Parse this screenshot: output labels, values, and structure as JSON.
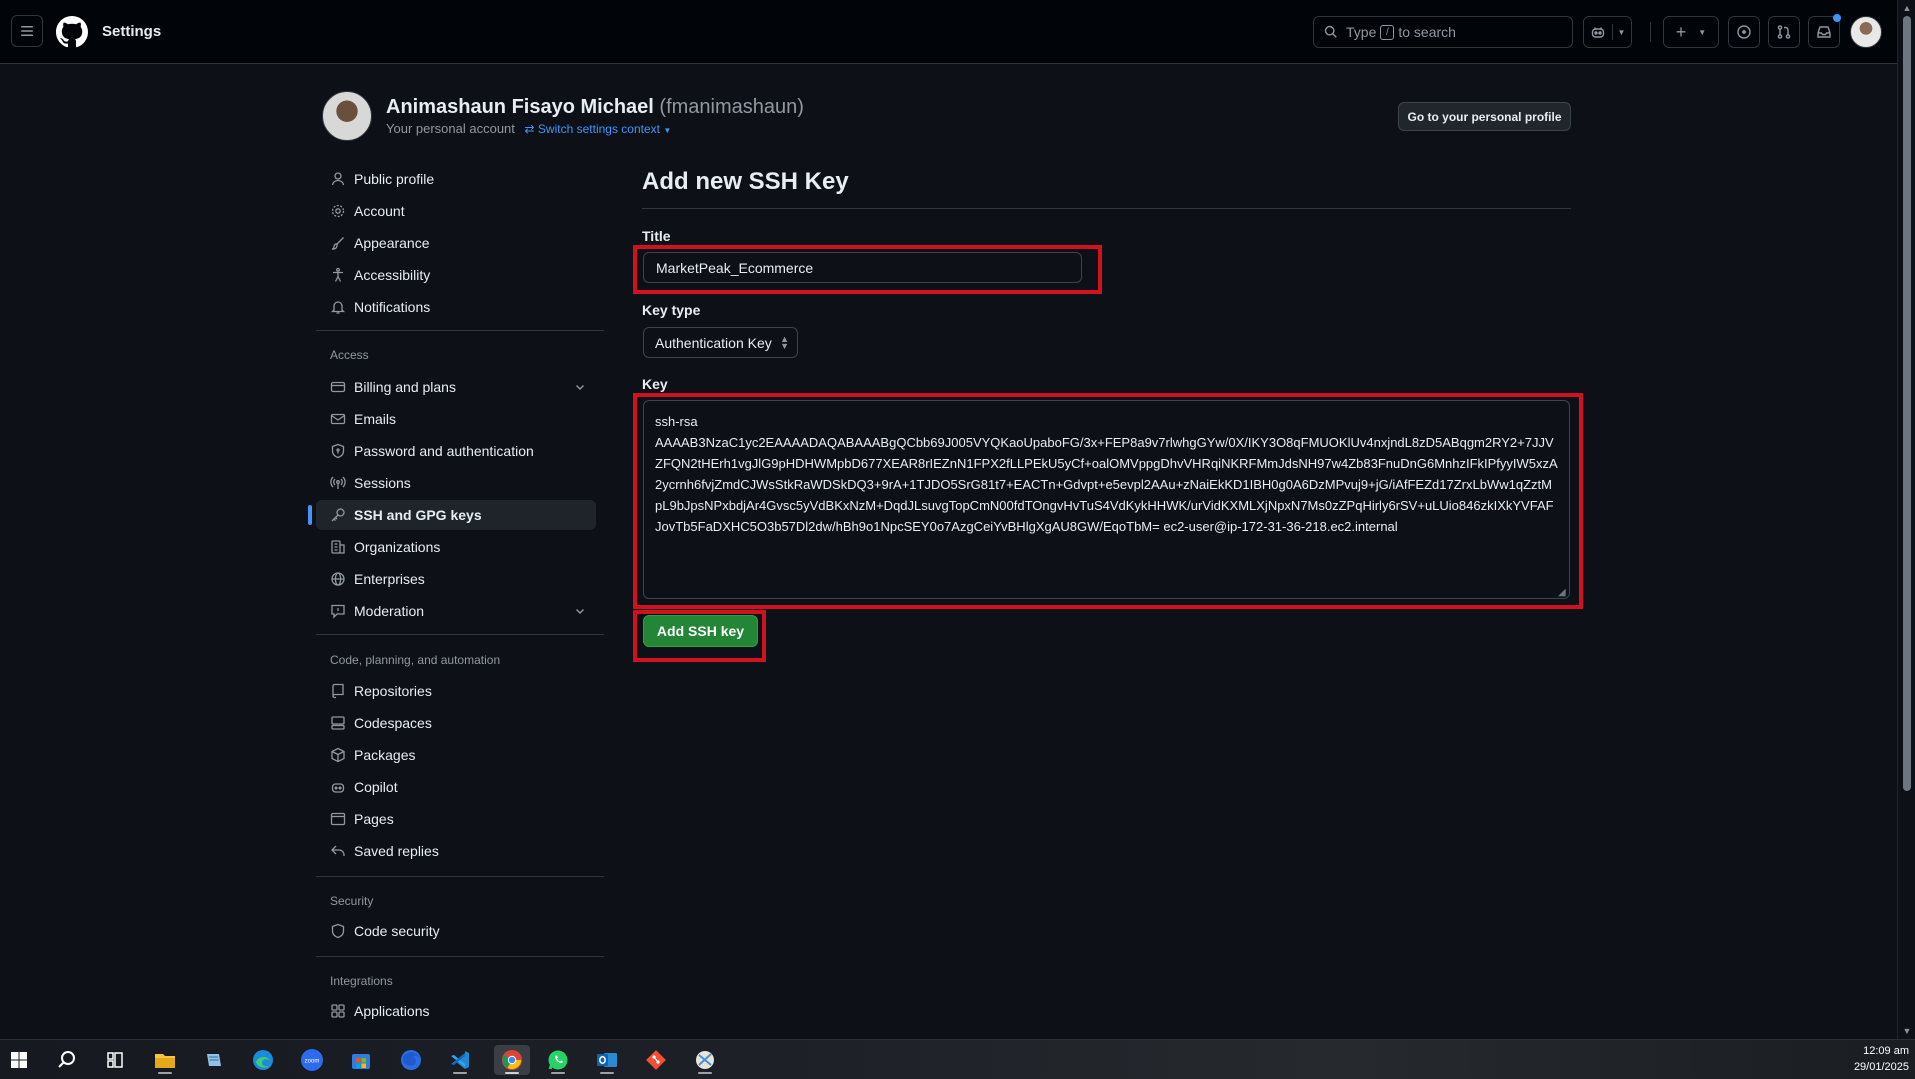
{
  "header": {
    "title": "Settings",
    "search_prefix": "Type",
    "search_key": "/",
    "search_suffix": "to search"
  },
  "profile": {
    "name": "Animashaun Fisayo Michael",
    "login": "(fmanimashaun)",
    "subtitle": "Your personal account",
    "switch_label": "Switch settings context",
    "go_profile_label": "Go to your personal profile"
  },
  "sidebar": {
    "items_top": [
      {
        "label": "Public profile",
        "icon": "person-icon"
      },
      {
        "label": "Account",
        "icon": "gear-icon"
      },
      {
        "label": "Appearance",
        "icon": "paintbrush-icon"
      },
      {
        "label": "Accessibility",
        "icon": "accessibility-icon"
      },
      {
        "label": "Notifications",
        "icon": "bell-icon"
      }
    ],
    "section_access": "Access",
    "items_access": [
      {
        "label": "Billing and plans",
        "icon": "credit-card-icon"
      },
      {
        "label": "Emails",
        "icon": "mail-icon"
      },
      {
        "label": "Password and authentication",
        "icon": "shield-lock-icon"
      },
      {
        "label": "Sessions",
        "icon": "broadcast-icon"
      },
      {
        "label": "SSH and GPG keys",
        "icon": "key-icon"
      },
      {
        "label": "Organizations",
        "icon": "organization-icon"
      },
      {
        "label": "Enterprises",
        "icon": "globe-icon"
      },
      {
        "label": "Moderation",
        "icon": "report-icon"
      }
    ],
    "section_code": "Code, planning, and automation",
    "items_code": [
      {
        "label": "Repositories",
        "icon": "repo-icon"
      },
      {
        "label": "Codespaces",
        "icon": "codespaces-icon"
      },
      {
        "label": "Packages",
        "icon": "package-icon"
      },
      {
        "label": "Copilot",
        "icon": "copilot-icon"
      },
      {
        "label": "Pages",
        "icon": "browser-icon"
      },
      {
        "label": "Saved replies",
        "icon": "reply-icon"
      }
    ],
    "section_security": "Security",
    "items_security": [
      {
        "label": "Code security",
        "icon": "shield-icon"
      }
    ],
    "section_integrations": "Integrations",
    "items_integrations": [
      {
        "label": "Applications",
        "icon": "apps-icon"
      }
    ]
  },
  "form": {
    "heading": "Add new SSH Key",
    "title_label": "Title",
    "title_value": "MarketPeak_Ecommerce",
    "keytype_label": "Key type",
    "keytype_value": "Authentication Key",
    "key_label": "Key",
    "key_value": "ssh-rsa\nAAAAB3NzaC1yc2EAAAADAQABAAABgQCbb69J005VYQKaoUpaboFG/3x+FEP8a9v7rlwhgGYw/0X/IKY3O8qFMUOKlUv4nxjndL8zD5ABqgm2RY2+7JJVZFQN2tHErh1vgJlG9pHDHWMpbD677XEAR8rIEZnN1FPX2fLLPEkU5yCf+oalOMVppgDhvVHRqiNKRFMmJdsNH97w4Zb83FnuDnG6MnhzIFkIPfyyIW5xzA2ycrnh6fvjZmdCJWsStkRaWDSkDQ3+9rA+1TJDO5SrG81t7+EACTn+Gdvpt+e5evpl2AAu+zNaiEkKD1IBH0g0A6DzMPvuj9+jG/iAfFEZd17ZrxLbWw1qZztMpL9bJpsNPxbdjAr4Gvsc5yVdBKxNzM+DqdJLsuvgTopCmN00fdTOngvHvTuS4VdKykHHWK/urVidKXMLXjNpxN7Ms0zZPqHirly6rSV+uLUio846zkIXkYVFAFJovTb5FaDXHC5O3b57Dl2dw/hBh9o1NpcSEY0o7AzgCeiYvBHlgXgAU8GW/EqoTbM= ec2-user@ip-172-31-36-218.ec2.internal",
    "submit_label": "Add SSH key"
  },
  "taskbar": {
    "time": "12:09 am",
    "date": "29/01/2025",
    "apps": [
      "windows-start-icon",
      "search-icon",
      "task-view-icon",
      "file-explorer-icon",
      "notepad-icon",
      "edge-icon",
      "zoom-icon",
      "store-icon",
      "firefox-icon",
      "vscode-icon",
      "chrome-icon",
      "whatsapp-icon",
      "outlook-icon",
      "git-icon",
      "snipping-icon"
    ]
  },
  "colors": {
    "accent_blue": "#4493f8",
    "success_green": "#238636",
    "highlight_red": "#d0111f"
  }
}
